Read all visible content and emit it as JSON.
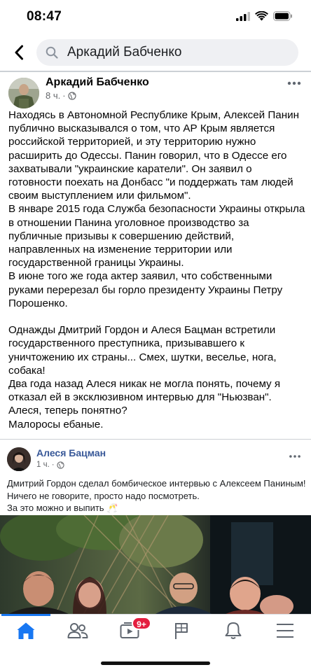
{
  "status_bar": {
    "time": "08:47"
  },
  "search": {
    "query": "Аркадий Бабченко"
  },
  "post": {
    "author": "Аркадий Бабченко",
    "time": "8 ч.",
    "separator": "·",
    "paragraphs": [
      "Находясь в Автономной Республике Крым, Алексей Панин публично высказывался о том, что АР Крым является российской территорией, и эту территорию нужно расширить до Одессы. Панин говорил, что в Одессе его захватывали \"украинские каратели\". Он заявил о готовности поехать на Донбасс \"и поддержать там людей своим выступлением или фильмом\".",
      "В январе 2015 года Служба безопасности Украины открыла в отношении Панина уголовное производство за публичные призывы к совершению действий, направленных на изменение территории или государственной границы Украины.",
      "В июне того же года актер заявил, что собственными руками перерезал бы горло президенту Украины Петру Порошенко.",
      " ",
      "Однажды Дмитрий Гордон и Алеся Бацман встретили государственного преступника, призывавшего к уничтожению их страны... Смех, шутки, веселье, нога, собака!",
      "Два года назад Алеся никак не могла понять, почему я отказал ей в эксклюзивном интервью для \"Ньюзван\".",
      "Алеся, теперь понятно?",
      "Малоросы ебаные."
    ]
  },
  "shared_post": {
    "author": "Алеся Бацман",
    "time": "1 ч.",
    "separator": "·",
    "lines": [
      "Дмитрий Гордон сделал бомбическое интервью с Алексеем Паниным!",
      "Ничего не говорите, просто надо посмотреть.",
      "За это можно и выпить 🥂"
    ]
  },
  "tab_bar": {
    "tabs": [
      "home-icon",
      "friends-icon",
      "watch-icon",
      "pages-icon",
      "notifications-icon",
      "menu-icon"
    ],
    "watch_badge": "9+",
    "active_color": "#1877f2"
  }
}
